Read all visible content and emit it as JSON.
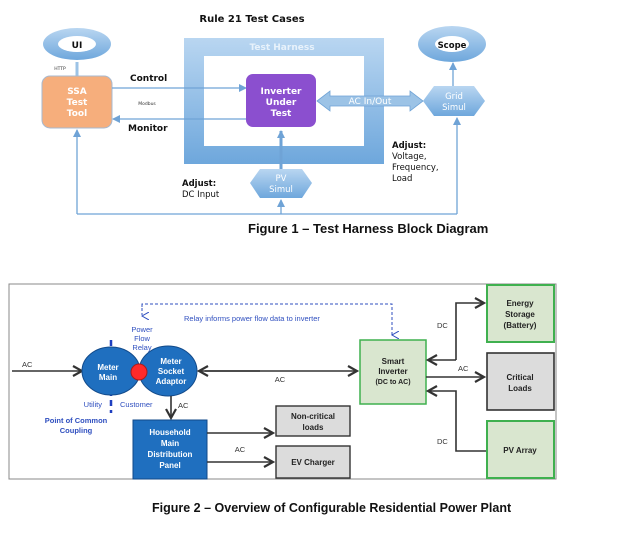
{
  "figure1": {
    "title": "Rule 21 Test Cases",
    "ui_label": "UI",
    "http_label": "HTTP",
    "ssa_lines": [
      "SSA",
      "Test",
      "Tool"
    ],
    "control_label": "Control",
    "modbus_label": "Modbus",
    "monitor_label": "Monitor",
    "harness_label": "Test Harness",
    "inverter_lines": [
      "Inverter",
      "Under",
      "Test"
    ],
    "ac_inout_label": "AC In/Out",
    "scope_label": "Scope",
    "grid_lines": [
      "Grid",
      "Simul"
    ],
    "pv_lines": [
      "PV",
      "Simul"
    ],
    "adjust_dc_lines": [
      "Adjust:",
      "DC Input"
    ],
    "adjust_grid_lines": [
      "Adjust:",
      "Voltage,",
      "Frequency,",
      "Load"
    ],
    "caption": "Figure 1 – Test Harness Block Diagram"
  },
  "figure2": {
    "relay_note": "Relay informs power flow data to inverter",
    "relay_lines": [
      "Power",
      "Flow",
      "Relay"
    ],
    "ac_in_label": "AC",
    "meter_main_lines": [
      "Meter",
      "Main"
    ],
    "meter_socket_lines": [
      "Meter",
      "Socket",
      "Adaptor"
    ],
    "utility_label": "Utility",
    "customer_label": "Customer",
    "pcc_lines": [
      "Point of Common",
      "Coupling"
    ],
    "ac_mid_label": "AC",
    "ac_down_label": "AC",
    "panel_lines": [
      "Household",
      "Main",
      "Distribution",
      "Panel"
    ],
    "noncritical_lines": [
      "Non-critical",
      "loads"
    ],
    "ac_panel_label": "AC",
    "ev_label": "EV Charger",
    "inverter_lines": [
      "Smart",
      "Inverter",
      "(DC to AC)"
    ],
    "dc_top_label": "DC",
    "ac_right_label": "AC",
    "dc_bottom_label": "DC",
    "storage_lines": [
      "Energy",
      "Storage",
      "(Battery)"
    ],
    "critical_lines": [
      "Critical",
      "Loads"
    ],
    "pv_label": "PV Array",
    "caption": "Figure 2 – Overview of Configurable Residential Power Plant"
  },
  "colors": {
    "light_blue": "#9cc3e6",
    "mid_blue": "#6fa3d6",
    "orange": "#f6ae7c",
    "purple": "#8b4fcf",
    "dark_blue": "#1f6fbf",
    "text_blue": "#1f3fbf",
    "green_fill": "#d9e6cf",
    "green_border": "#3fb04f",
    "gray_fill": "#dcdcdc",
    "red": "#ff2a2a"
  }
}
